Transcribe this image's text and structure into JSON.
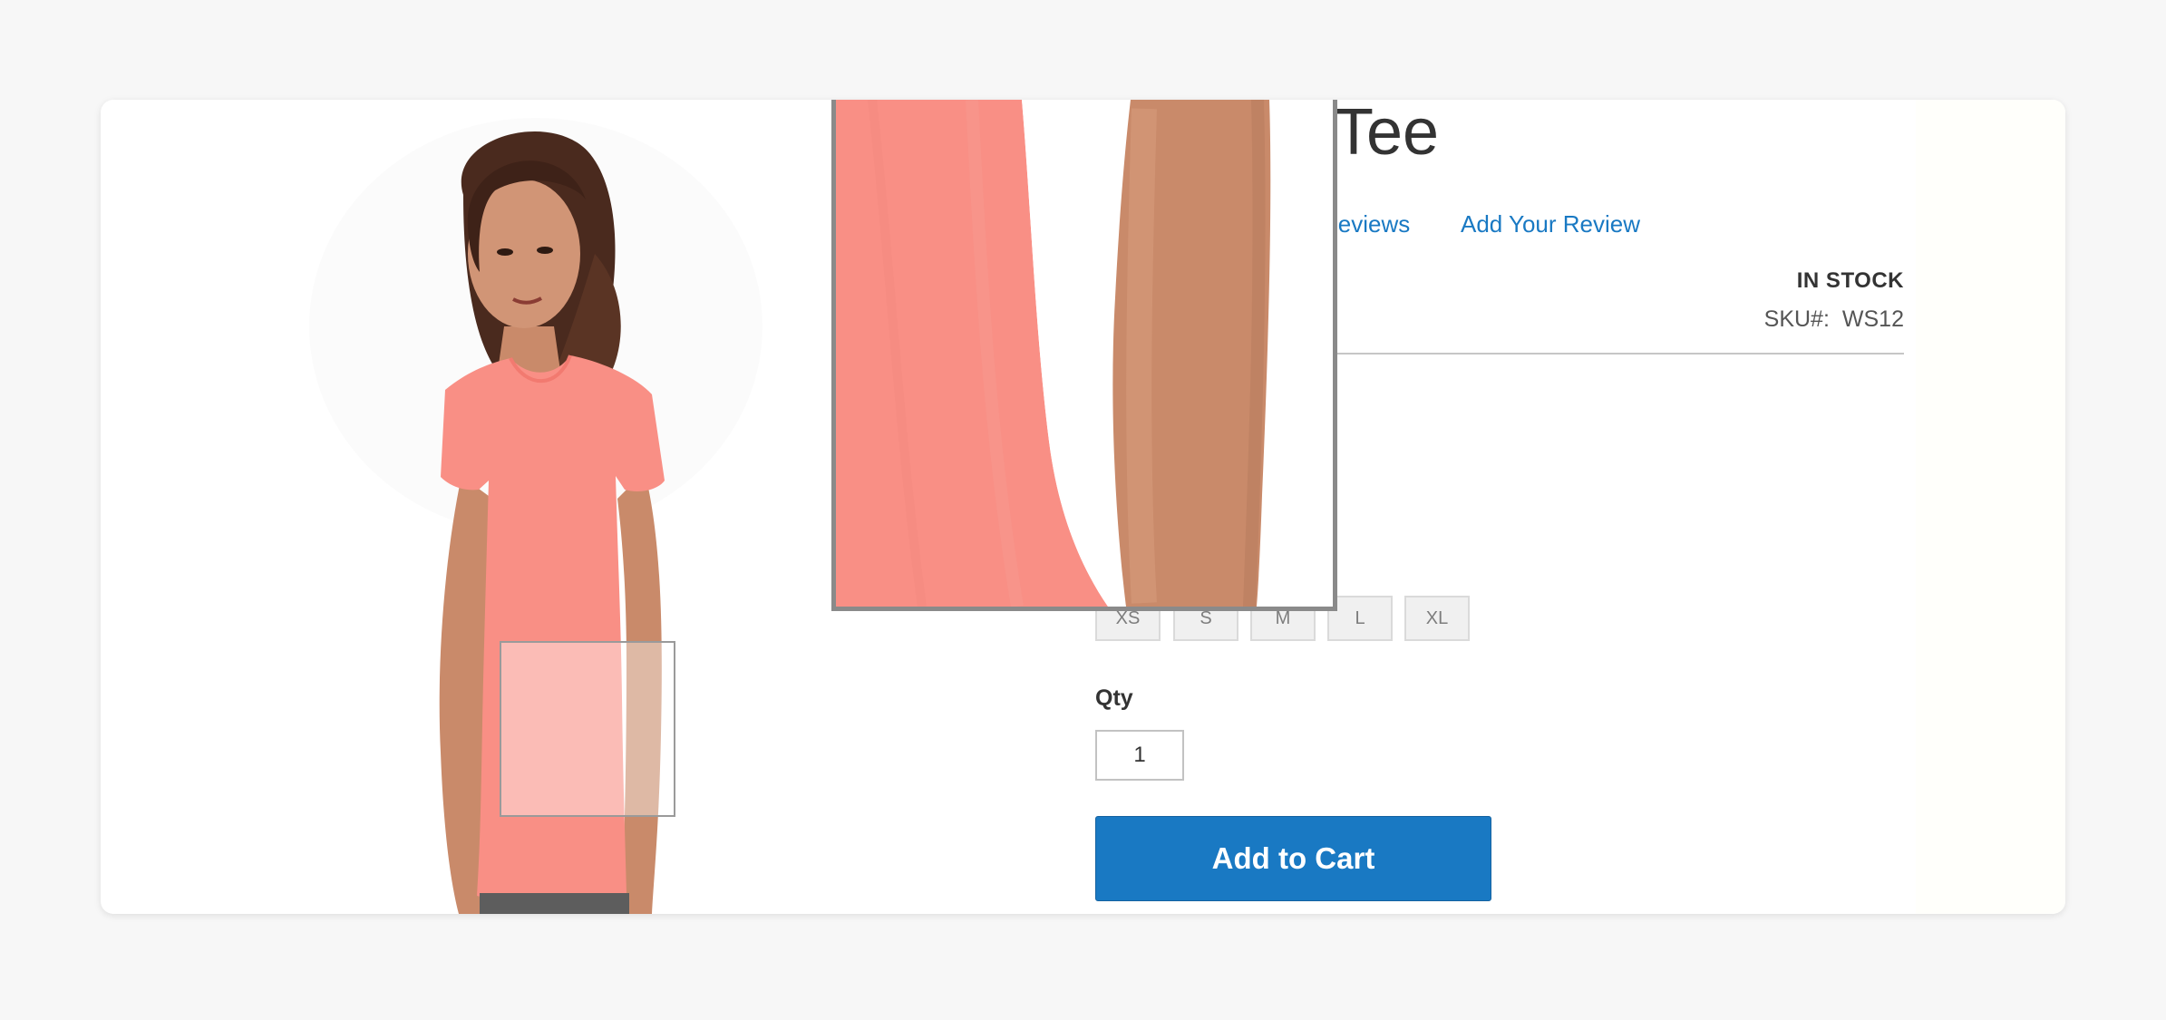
{
  "product": {
    "title": "Tee",
    "reviews_link": "Reviews",
    "add_review_link": "Add Your Review",
    "stock_status": "IN STOCK",
    "sku_label": "SKU#:",
    "sku_value": "WS12"
  },
  "sizes": [
    {
      "label": "XS"
    },
    {
      "label": "S"
    },
    {
      "label": "M"
    },
    {
      "label": "L"
    },
    {
      "label": "XL"
    }
  ],
  "qty": {
    "label": "Qty",
    "value": "1"
  },
  "add_to_cart_label": "Add to Cart",
  "colors": {
    "accent": "#1979c3",
    "tee": "#f98f85",
    "skin": "#c98a6a"
  }
}
